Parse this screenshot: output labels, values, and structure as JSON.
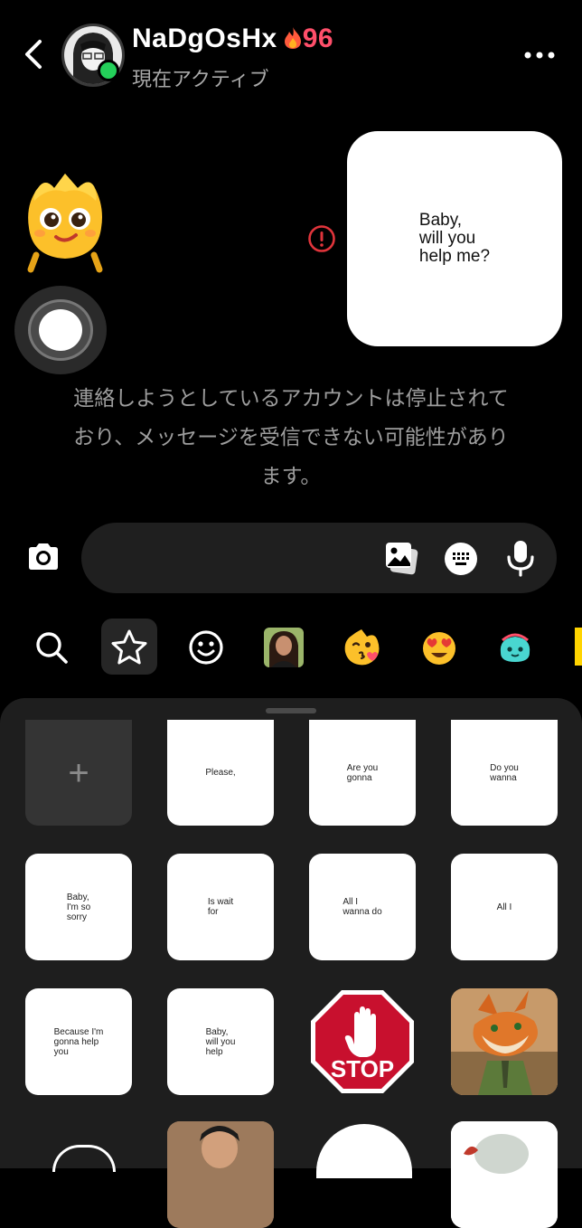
{
  "header": {
    "username": "NaDgOsHx",
    "streak_icon": "fire",
    "streak_count": "96",
    "status": "現在アクティブ"
  },
  "chat": {
    "sent_sticker_text": "Baby,\nwill you\nhelp me?",
    "notice": "連絡しようとしているアカウントは停止されており、メッセージを受信できない可能性があります。"
  },
  "tabs": [
    {
      "icon": "search-icon"
    },
    {
      "icon": "star-icon",
      "active": true
    },
    {
      "icon": "smiley-icon"
    },
    {
      "icon": "portrait-sticker-icon"
    },
    {
      "icon": "kiss-emoji-icon"
    },
    {
      "icon": "heart-eyes-emoji-icon"
    },
    {
      "icon": "blob-creature-icon"
    }
  ],
  "stickers": {
    "add_label": "+",
    "row0": [
      "Please,",
      "Are you\ngonna",
      "Do you\nwanna"
    ],
    "row1": [
      "Baby,\nI'm so\nsorry",
      "Is wait\nfor",
      "All I\nwanna do",
      "All I"
    ],
    "row2": [
      "Because I'm\ngonna help\nyou",
      "Baby,\nwill you\nhelp"
    ],
    "stop_sign_text": "STOP"
  },
  "colors": {
    "background": "#000000",
    "online": "#24d05a",
    "streak": "#ff4f6a",
    "error": "#e0343b",
    "panel": "#1e1e1e"
  }
}
